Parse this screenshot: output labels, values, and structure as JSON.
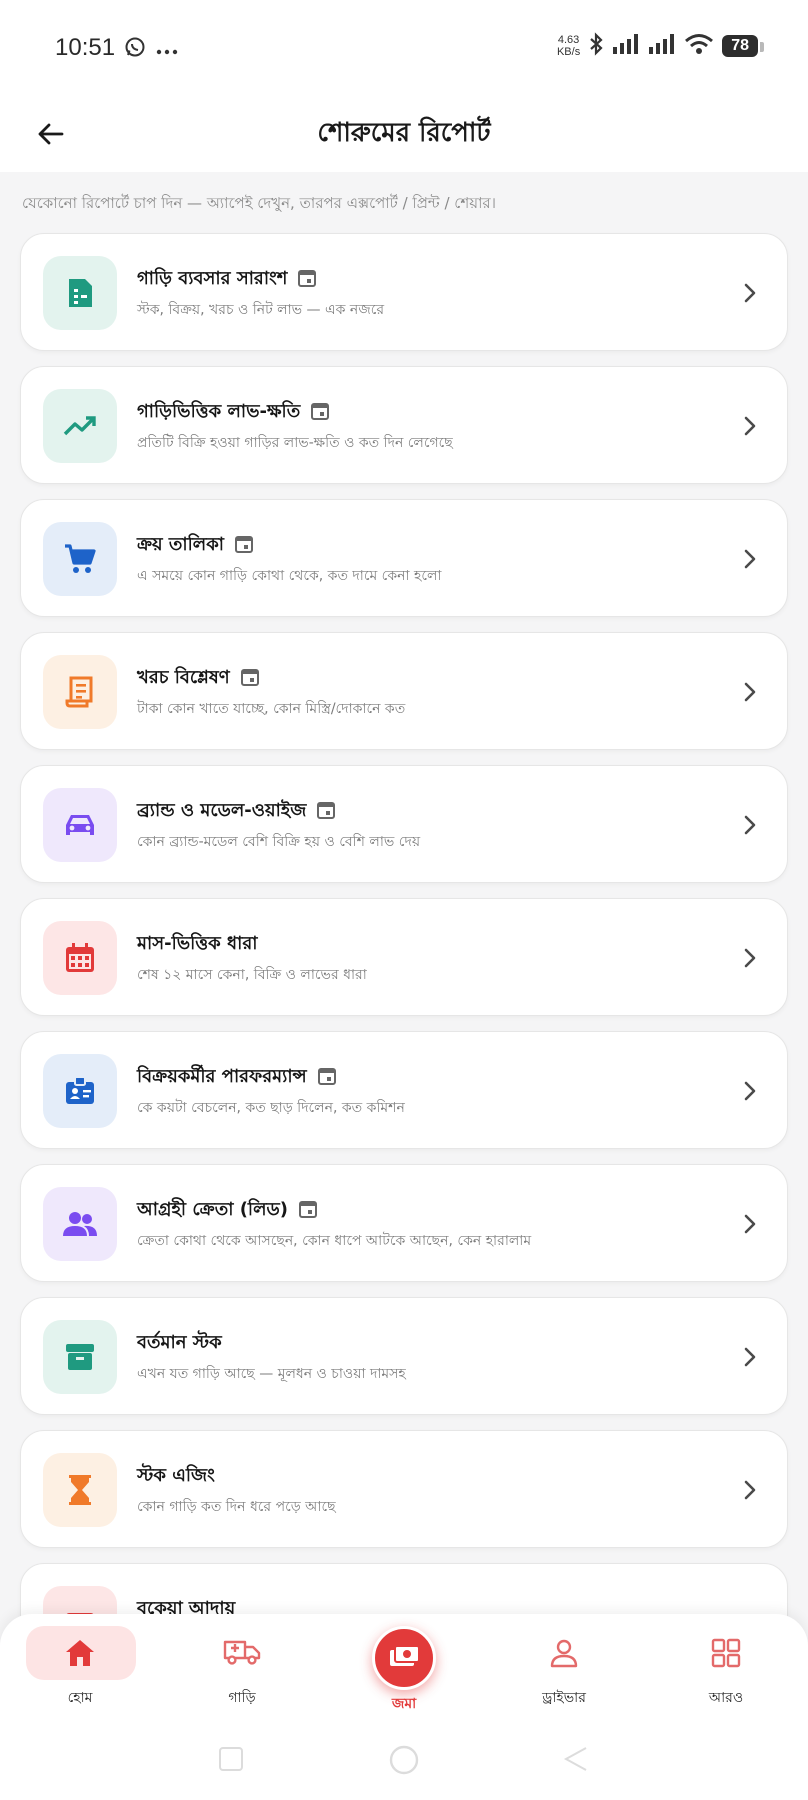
{
  "status_bar": {
    "time": "10:51",
    "net_speed_value": "4.63",
    "net_speed_unit": "KB/s",
    "battery": "78"
  },
  "header": {
    "title": "শোরুমের রিপোর্ট"
  },
  "hint": "যেকোনো রিপোর্টে চাপ দিন — অ্যাপেই দেখুন, তারপর এক্সপোর্ট / প্রিন্ট / শেয়ার।",
  "colors": {
    "accent": "#e23a3a",
    "teal": "#1f9a80",
    "blue": "#1e63c9",
    "orange": "#f07a2a",
    "purple": "#7a4cf0",
    "red": "#e23a3a"
  },
  "reports": [
    {
      "title": "গাড়ি ব্যবসার সারাংশ",
      "subtitle": "স্টক, বিক্রয়, খরচ ও নিট লাভ — এক নজরে",
      "icon": "document-icon",
      "date_filter": true
    },
    {
      "title": "গাড়িভিত্তিক লাভ-ক্ষতি",
      "subtitle": "প্রতিটি বিক্রি হওয়া গাড়ির লাভ-ক্ষতি ও কত দিন লেগেছে",
      "icon": "trending-up-icon",
      "date_filter": true
    },
    {
      "title": "ক্রয় তালিকা",
      "subtitle": "এ সময়ে কোন গাড়ি কোথা থেকে, কত দামে কেনা হলো",
      "icon": "cart-icon",
      "date_filter": true
    },
    {
      "title": "খরচ বিশ্লেষণ",
      "subtitle": "টাকা কোন খাতে যাচ্ছে, কোন মিস্ত্রি/দোকানে কত",
      "icon": "receipt-icon",
      "date_filter": true
    },
    {
      "title": "ব্র্যান্ড ও মডেল-ওয়াইজ",
      "subtitle": "কোন ব্র্যান্ড-মডেল বেশি বিক্রি হয় ও বেশি লাভ দেয়",
      "icon": "car-icon",
      "date_filter": true
    },
    {
      "title": "মাস-ভিত্তিক ধারা",
      "subtitle": "শেষ ১২ মাসে কেনা, বিক্রি ও লাভের ধারা",
      "icon": "calendar-icon",
      "date_filter": false
    },
    {
      "title": "বিক্রয়কর্মীর পারফরম্যান্স",
      "subtitle": "কে কয়টা বেচলেন, কত ছাড় দিলেন, কত কমিশন",
      "icon": "id-badge-icon",
      "date_filter": true
    },
    {
      "title": "আগ্রহী ক্রেতা (লিড)",
      "subtitle": "ক্রেতা কোথা থেকে আসছেন, কোন ধাপে আটকে আছেন, কেন হারালাম",
      "icon": "people-icon",
      "date_filter": true
    },
    {
      "title": "বর্তমান স্টক",
      "subtitle": "এখন যত গাড়ি আছে — মূলধন ও চাওয়া দামসহ",
      "icon": "archive-icon",
      "date_filter": false
    },
    {
      "title": "স্টক এজিং",
      "subtitle": "কোন গাড়ি কত দিন ধরে পড়ে আছে",
      "icon": "hourglass-icon",
      "date_filter": false
    },
    {
      "title": "বকেয়া আদায়",
      "subtitle": "",
      "icon": "wallet-icon",
      "date_filter": false
    }
  ],
  "bottom_nav": {
    "home": "হোম",
    "cars": "গাড়ি",
    "deposit": "জমা",
    "driver": "ড্রাইভার",
    "more": "আরও"
  }
}
